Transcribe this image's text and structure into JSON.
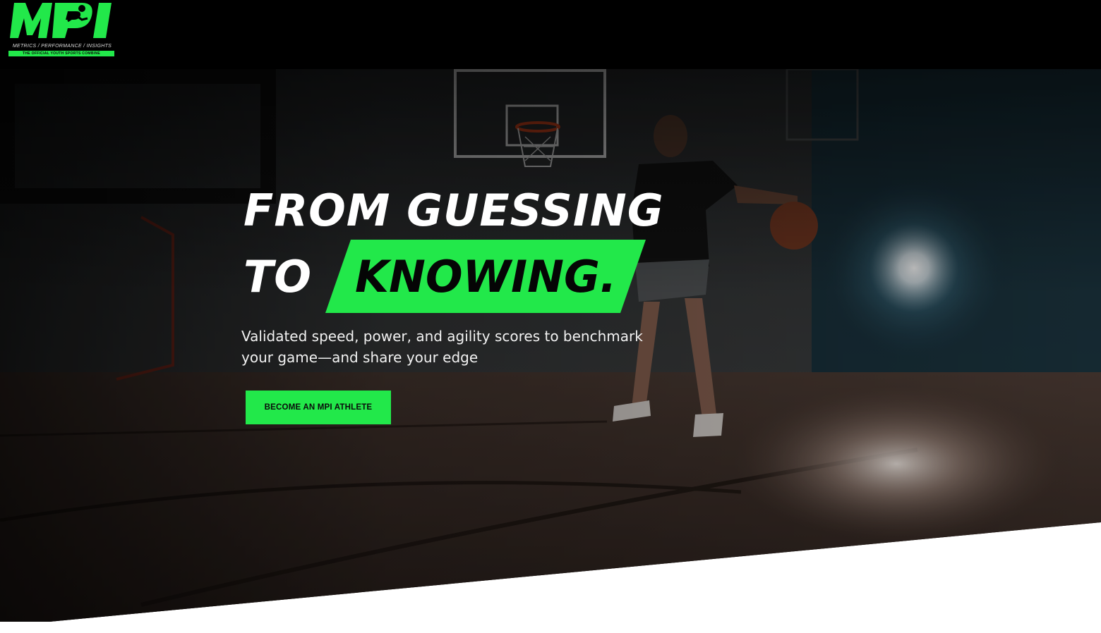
{
  "brand": {
    "logo_text": "MPI",
    "tagline": "METRICS / PERFORMANCE / INSIGHTS",
    "subline": "THE OFFICIAL YOUTH SPORTS COMBINE",
    "accent_color": "#22e84a",
    "header_color": "#000000"
  },
  "hero": {
    "headline_line1": "FROM GUESSING",
    "headline_to": "TO",
    "headline_highlight": "KNOWING.",
    "subtitle": "Validated speed, power, and agility scores to benchmark your game—and share your edge",
    "cta_label": "BECOME AN MPI ATHLETE",
    "background": "basketball-player-dribbling-in-dark-gym"
  }
}
